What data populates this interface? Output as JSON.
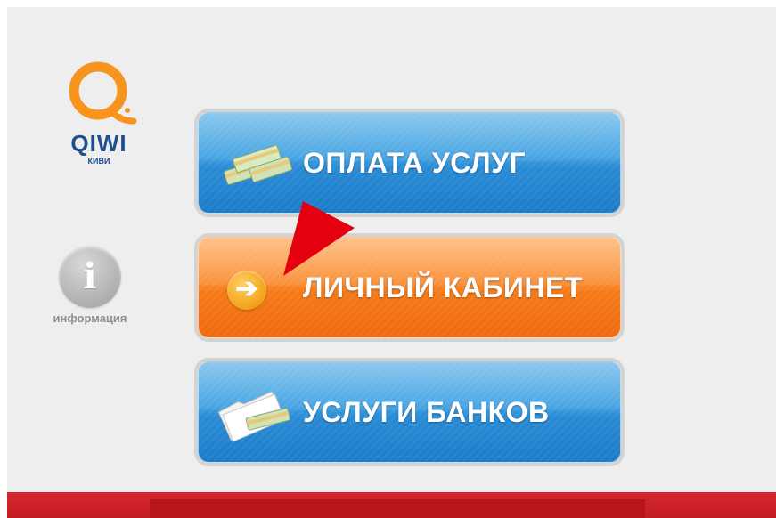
{
  "logo": {
    "word": "QIWI",
    "sub": "КИВИ",
    "color": "#f7941d",
    "text_color": "#1f4e8c"
  },
  "info": {
    "glyph": "i",
    "label": "информация",
    "icon": "info-icon"
  },
  "menu": [
    {
      "label": "ОПЛАТА УСЛУГ",
      "style": "blue",
      "icon": "money-stack-icon"
    },
    {
      "label": "ЛИЧНЫЙ КАБИНЕТ",
      "style": "orange",
      "icon": "arrow-right-icon",
      "glyph": "➔"
    },
    {
      "label": "УСЛУГИ БАНКОВ",
      "style": "blue",
      "icon": "folder-money-icon"
    }
  ],
  "colors": {
    "blue": "#2a8bd5",
    "orange": "#f47a18",
    "footer": "#c11b22",
    "pointer": "#e4000f"
  }
}
